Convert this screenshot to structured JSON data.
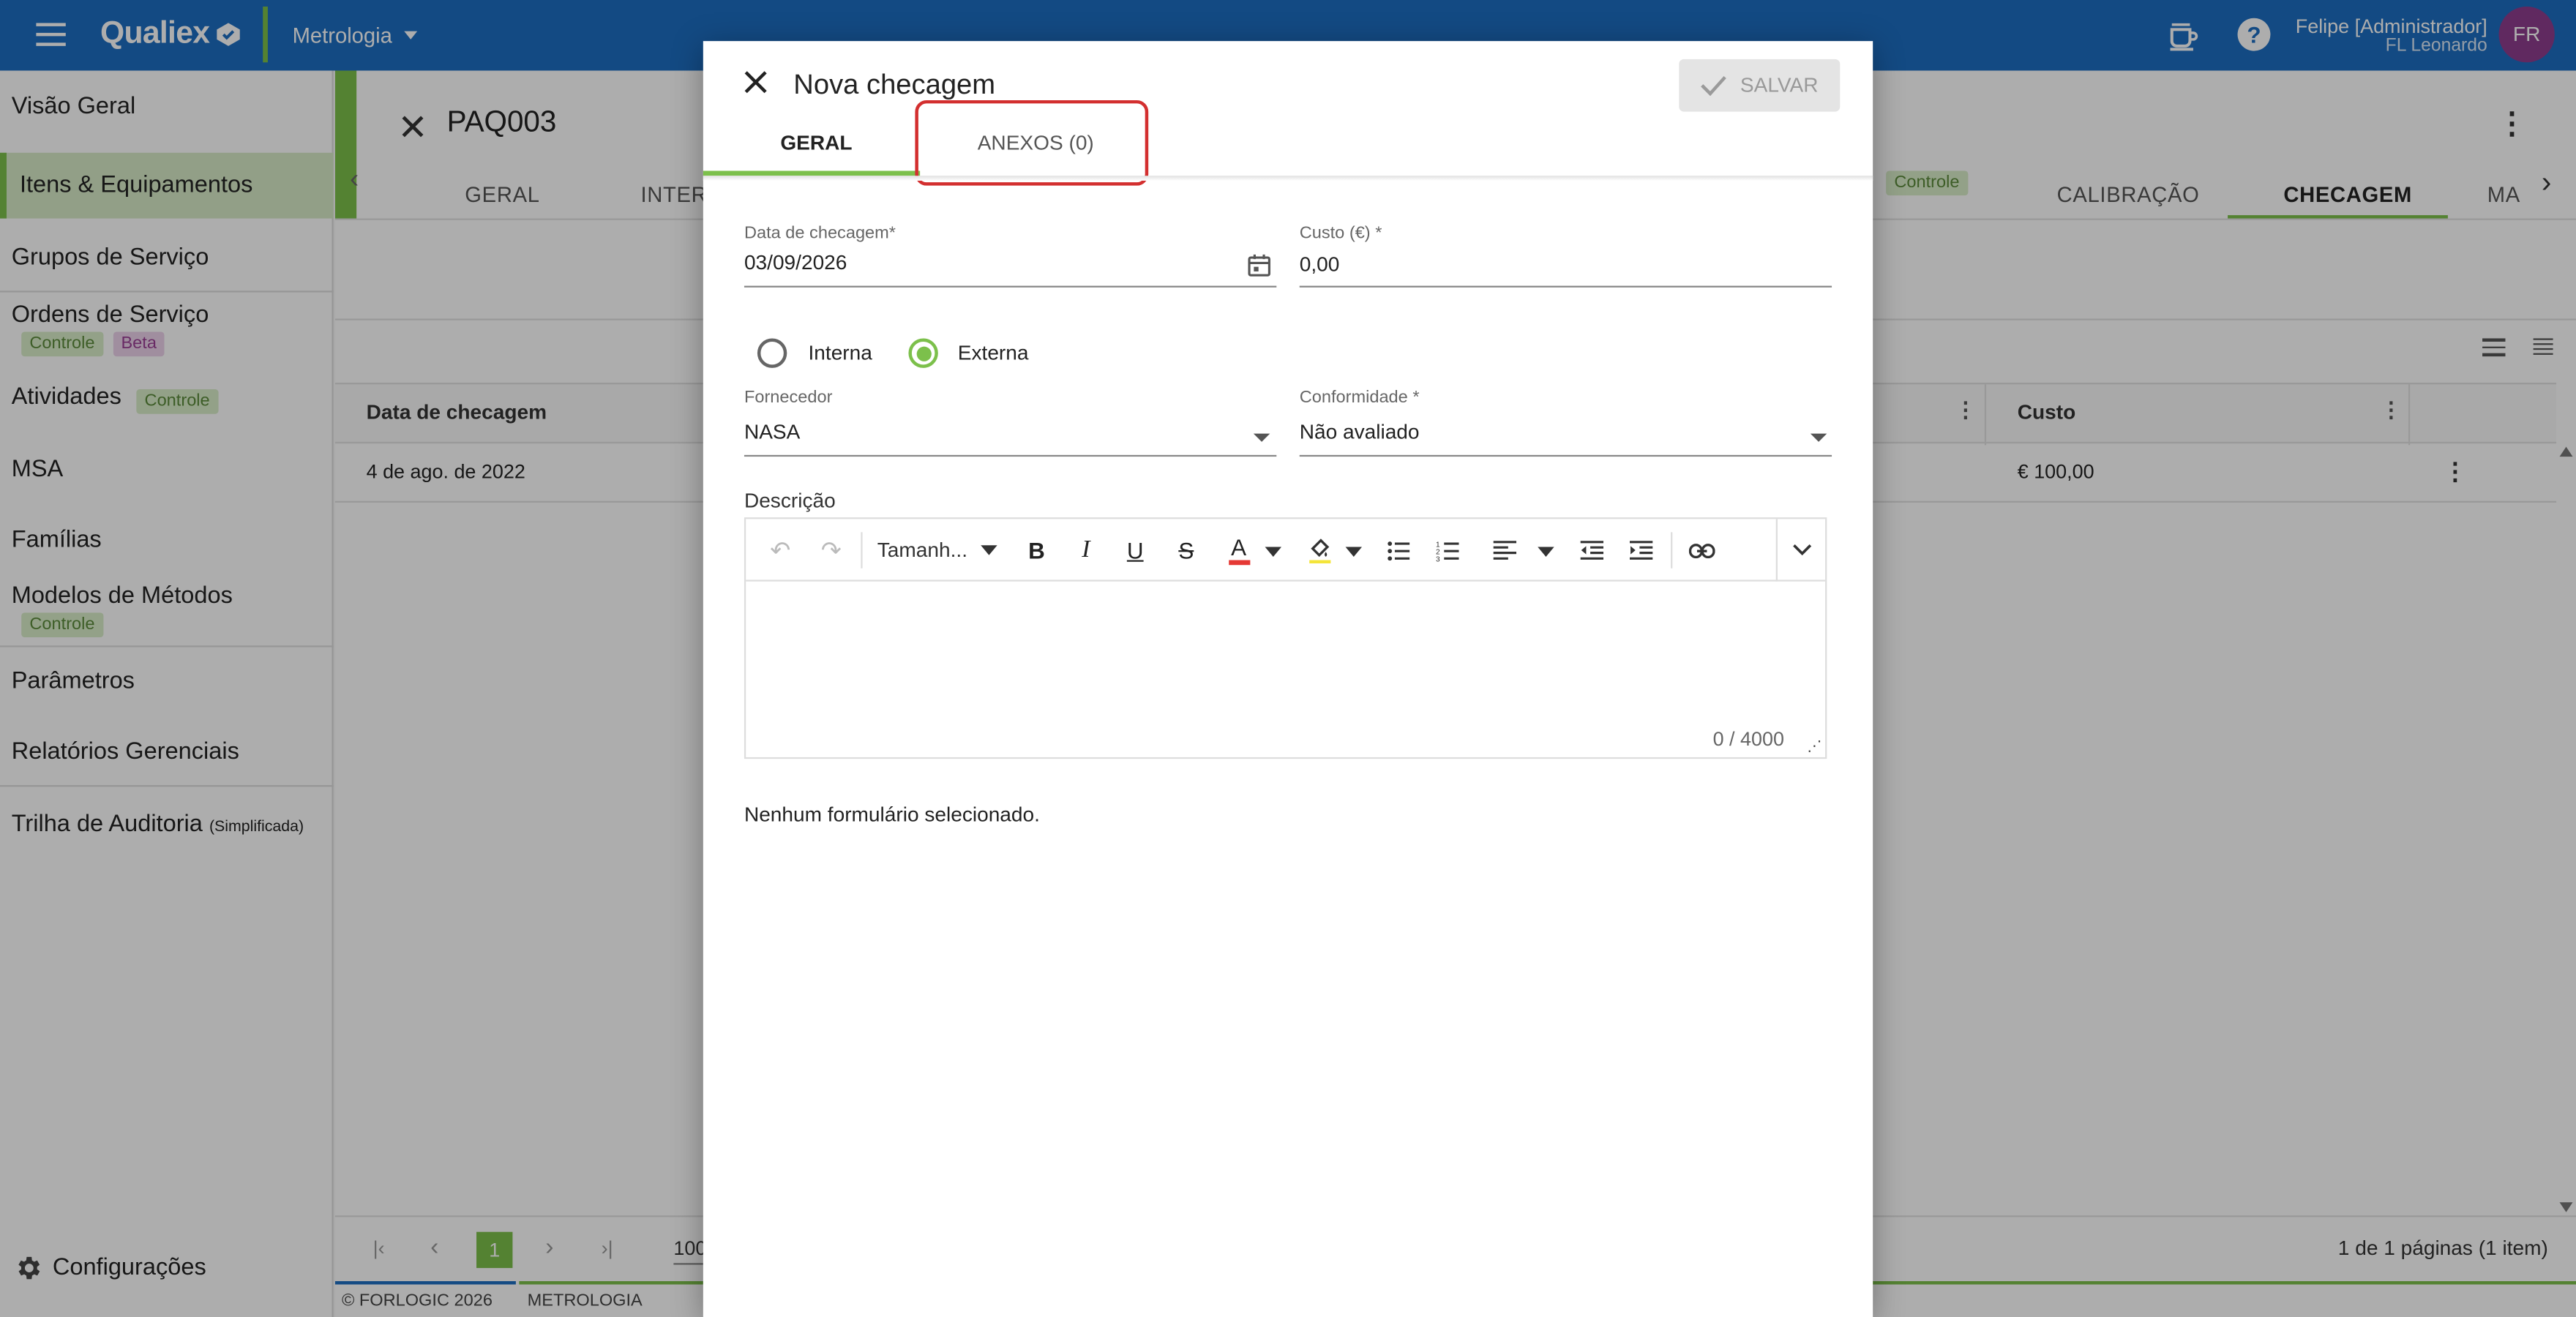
{
  "app": {
    "logo": "Qualiex",
    "module": "Metrologia"
  },
  "user": {
    "name": "Felipe [Administrador]",
    "org": "FL Leonardo",
    "initials": "FR",
    "avatar_color": "#8e3d8e"
  },
  "sidebar": {
    "items": [
      {
        "label": "Visão Geral"
      },
      {
        "label": "Itens & Equipamentos"
      },
      {
        "label": "Grupos de Serviço"
      },
      {
        "label": "Ordens de Serviço",
        "badges": [
          "Controle",
          "Beta"
        ]
      },
      {
        "label": "Atividades",
        "badges": [
          "Controle"
        ]
      },
      {
        "label": "MSA"
      },
      {
        "label": "Famílias"
      },
      {
        "label": "Modelos de Métodos",
        "badges": [
          "Controle"
        ]
      },
      {
        "label": "Parâmetros"
      },
      {
        "label": "Relatórios Gerenciais"
      },
      {
        "label": "Trilha de Auditoria",
        "suffix": "(Simplificada)"
      }
    ],
    "settings": "Configurações"
  },
  "page": {
    "code": "PAQ003",
    "tabs": [
      "GERAL",
      "INTER",
      "Controle",
      "CALIBRAÇÃO",
      "CHECAGEM",
      "MA"
    ],
    "table": {
      "headers": [
        "Data de checagem",
        "Custo"
      ],
      "row": {
        "date": "4 de ago. de 2022",
        "cost": "€ 100,00"
      }
    },
    "pagination": {
      "current": "1",
      "size": "100",
      "summary": "1 de 1 páginas (1 item)"
    },
    "footer": {
      "copyright": "© FORLOGIC 2026",
      "module": "METROLOGIA"
    }
  },
  "dialog": {
    "title": "Nova checagem",
    "save_label": "SALVAR",
    "tabs": [
      "GERAL",
      "ANEXOS (0)"
    ],
    "date": {
      "label": "Data de checagem*",
      "value": "03/09/2026"
    },
    "cost": {
      "label": "Custo (€) *",
      "value": "0,00"
    },
    "radio": {
      "internal": "Interna",
      "external": "Externa",
      "selected": "Externa"
    },
    "supplier": {
      "label": "Fornecedor",
      "value": "NASA"
    },
    "conformity": {
      "label": "Conformidade *",
      "value": "Não avaliado"
    },
    "description": {
      "label": "Descrição",
      "font_size": "Tamanh...",
      "counter": "0 / 4000"
    },
    "no_form": "Nenhum formulário selecionado."
  },
  "colors": {
    "primary": "#1d6ec2",
    "accent_green": "#7cc04b",
    "highlight": "#d32f2f"
  }
}
